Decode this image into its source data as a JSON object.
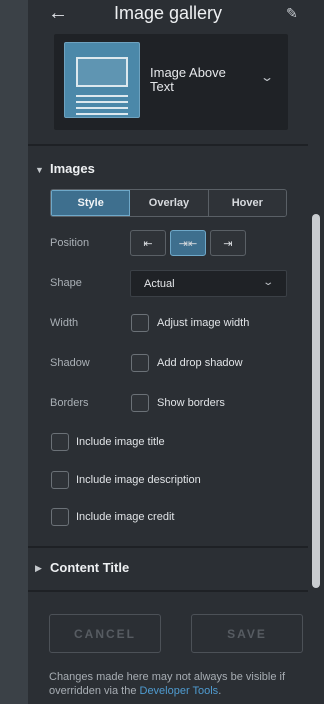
{
  "header": {
    "title": "Image gallery",
    "back_icon": "←",
    "edit_icon": "✎"
  },
  "layout": {
    "selected": "Image Above Text"
  },
  "images_section": {
    "title": "Images",
    "tabs": [
      "Style",
      "Overlay",
      "Hover"
    ],
    "active_tab": "Style",
    "position": {
      "label": "Position",
      "options": [
        "⇤",
        "⇥⇤",
        "⇥"
      ],
      "active_index": 1
    },
    "shape": {
      "label": "Shape",
      "value": "Actual"
    },
    "width": {
      "label": "Width",
      "option": "Adjust image width",
      "checked": false
    },
    "shadow": {
      "label": "Shadow",
      "option": "Add drop shadow",
      "checked": false
    },
    "borders": {
      "label": "Borders",
      "option": "Show borders",
      "checked": false
    },
    "include_title": {
      "option": "Include image title",
      "checked": false
    },
    "include_description": {
      "option": "Include image description",
      "checked": false
    },
    "include_credit": {
      "option": "Include image credit",
      "checked": false
    }
  },
  "content_title_section": {
    "title": "Content Title"
  },
  "footer": {
    "cancel_label": "CANCEL",
    "save_label": "SAVE",
    "note_prefix": "Changes made here may not always be visible if overridden via the ",
    "note_link": "Developer Tools",
    "note_suffix": "."
  },
  "colors": {
    "accent": "#3e6f8e",
    "link": "#4f9bd0",
    "panel": "#2b2f34"
  }
}
